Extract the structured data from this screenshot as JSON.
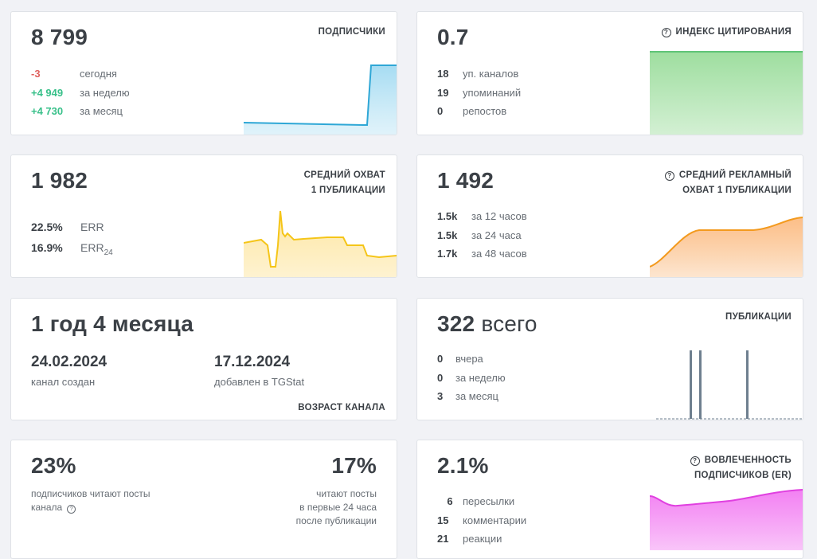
{
  "subscribers": {
    "value": "8 799",
    "title": "ПОДПИСЧИКИ",
    "rows": [
      {
        "value": "-3",
        "label": "сегодня"
      },
      {
        "value": "+4 949",
        "label": "за неделю"
      },
      {
        "value": "+4 730",
        "label": "за месяц"
      }
    ],
    "spark_color": "#2ea7d6"
  },
  "citation": {
    "value": "0.7",
    "title": "ИНДЕКС ЦИТИРОВАНИЯ",
    "rows": [
      {
        "value": "18",
        "label": "уп. каналов"
      },
      {
        "value": "19",
        "label": "упоминаний"
      },
      {
        "value": "0",
        "label": "репостов"
      }
    ],
    "spark_color": "#5fc477"
  },
  "reach": {
    "value": "1 982",
    "title_line1": "СРЕДНИЙ ОХВАТ",
    "title_line2": "1 ПУБЛИКАЦИИ",
    "rows": [
      {
        "value": "22.5%",
        "label": "ERR",
        "sub": ""
      },
      {
        "value": "16.9%",
        "label": "ERR",
        "sub": "24"
      }
    ],
    "spark_color": "#f5c518"
  },
  "ad_reach": {
    "value": "1 492",
    "title_line1": "СРЕДНИЙ РЕКЛАМНЫЙ",
    "title_line2": "ОХВАТ 1 ПУБЛИКАЦИИ",
    "rows": [
      {
        "value": "1.5k",
        "label": "за 12 часов"
      },
      {
        "value": "1.5k",
        "label": "за 24 часа"
      },
      {
        "value": "1.7k",
        "label": "за 48 часов"
      }
    ],
    "spark_color": "#f39a1e"
  },
  "age": {
    "value": "1 год 4 месяца",
    "created_date": "24.02.2024",
    "created_label": "канал создан",
    "added_date": "17.12.2024",
    "added_label": "добавлен в TGStat",
    "title": "ВОЗРАСТ КАНАЛА"
  },
  "posts": {
    "value": "322",
    "suffix": "всего",
    "title": "ПУБЛИКАЦИИ",
    "rows": [
      {
        "value": "0",
        "label": "вчера"
      },
      {
        "value": "0",
        "label": "за неделю"
      },
      {
        "value": "3",
        "label": "за месяц"
      }
    ],
    "bar_color": "#6e7f8f"
  },
  "readers": {
    "left_value": "23%",
    "left_label_line1": "подписчиков читают посты",
    "left_label_line2": "канала",
    "right_value": "17%",
    "right_label_line1": "читают посты",
    "right_label_line2": "в первые 24 часа",
    "right_label_line3": "после публикации"
  },
  "engagement": {
    "value": "2.1%",
    "title_line1": "ВОВЛЕЧЕННОСТЬ",
    "title_line2": "ПОДПИСЧИКОВ (ER)",
    "rows": [
      {
        "value": "6",
        "label": "пересылки"
      },
      {
        "value": "15",
        "label": "комментарии"
      },
      {
        "value": "21",
        "label": "реакции"
      }
    ],
    "spark_color": "#e040e0"
  }
}
